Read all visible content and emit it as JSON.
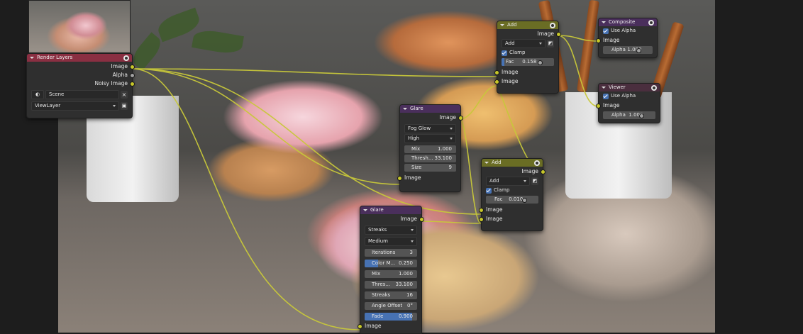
{
  "render_layers": {
    "title": "Render Layers",
    "outputs": [
      "Image",
      "Alpha",
      "Noisy Image"
    ],
    "scene": "Scene",
    "view_layer": "ViewLayer"
  },
  "add_top": {
    "title": "Add",
    "output": "Image",
    "blend_mode": "Add",
    "clamp_label": "Clamp",
    "fac_label": "Fac",
    "fac_value": "0.158",
    "inputs": [
      "Image",
      "Image"
    ]
  },
  "composite": {
    "title": "Composite",
    "use_alpha_label": "Use Alpha",
    "input": "Image",
    "alpha_label": "Alpha",
    "alpha_value": "1.000"
  },
  "viewer": {
    "title": "Viewer",
    "use_alpha_label": "Use Alpha",
    "input": "Image",
    "alpha_label": "Alpha",
    "alpha_value": "1.000"
  },
  "glare_fog": {
    "title": "Glare",
    "output": "Image",
    "type": "Fog Glow",
    "quality": "High",
    "mix_label": "Mix",
    "mix_value": "1.000",
    "threshold_label": "Thresh...",
    "threshold_value": "33.100",
    "size_label": "Size",
    "size_value": "9",
    "input": "Image"
  },
  "add_mid": {
    "title": "Add",
    "output": "Image",
    "blend_mode": "Add",
    "clamp_label": "Clamp",
    "fac_label": "Fac",
    "fac_value": "0.010",
    "inputs": [
      "Image",
      "Image"
    ]
  },
  "glare_streaks": {
    "title": "Glare",
    "output": "Image",
    "type": "Streaks",
    "quality": "Medium",
    "iterations_label": "Iterations",
    "iterations_value": "3",
    "color_mod_label": "Color M...",
    "color_mod_value": "0.250",
    "color_mod_fraction": 0.25,
    "mix_label": "Mix",
    "mix_value": "1.000",
    "threshold_label": "Thres...",
    "threshold_value": "33.100",
    "streaks_label": "Streaks",
    "streaks_value": "16",
    "angle_label": "Angle Offset",
    "angle_value": "0°",
    "fade_label": "Fade",
    "fade_value": "0.900",
    "fade_fraction": 0.9,
    "input": "Image"
  },
  "colors": {
    "socket_image": "#c7c729",
    "socket_value": "#a1a1a1",
    "wire": "#c8c83a",
    "slider_fill": "#4772b3"
  }
}
